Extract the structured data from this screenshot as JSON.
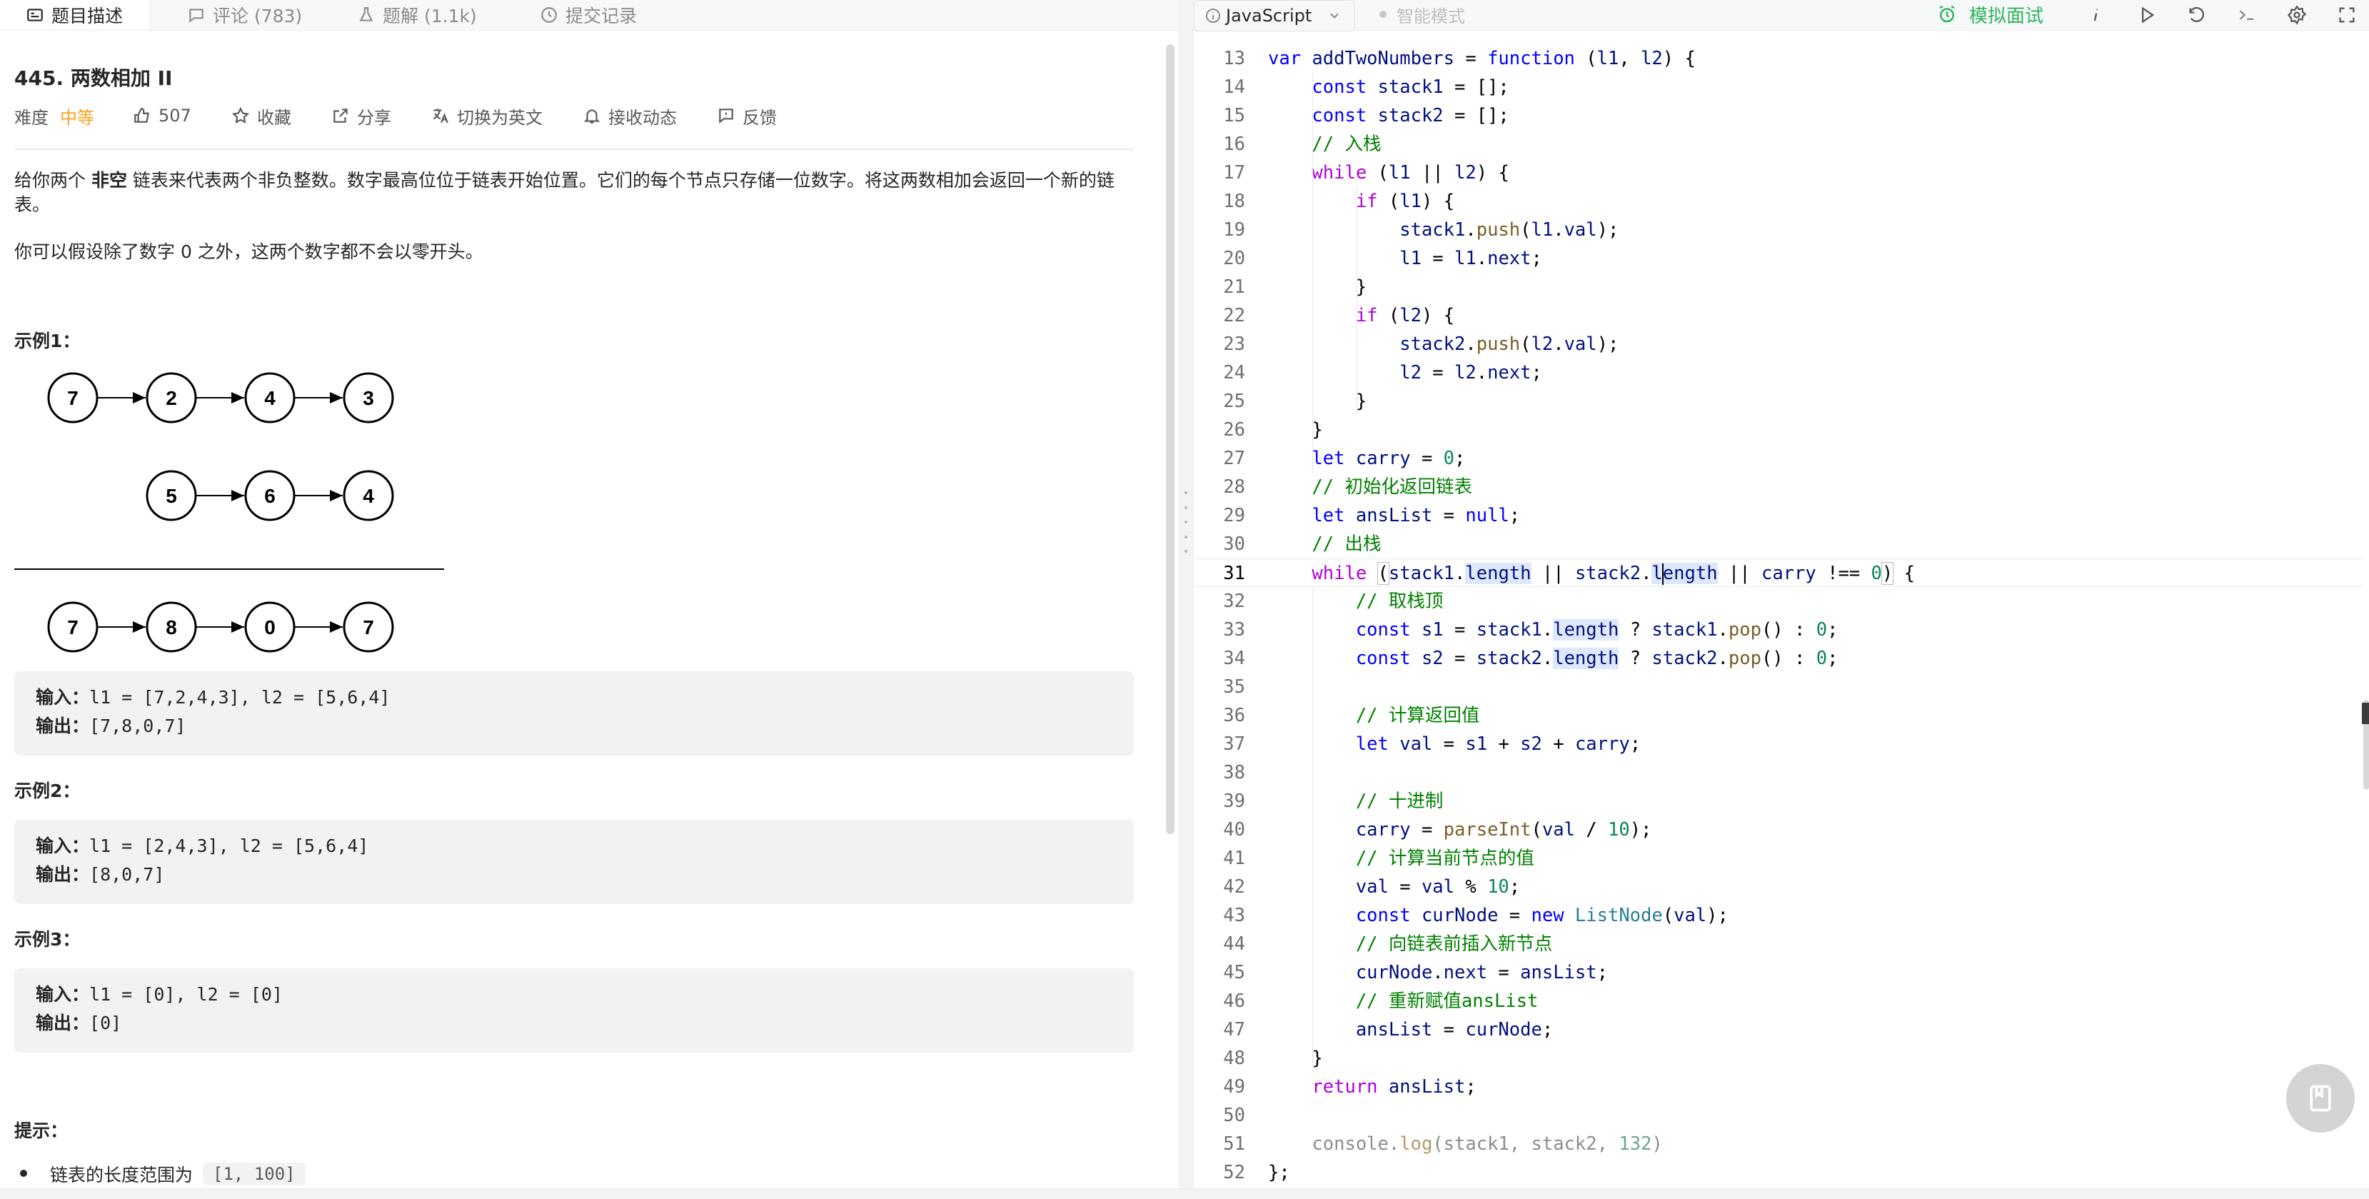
{
  "left_tabs": [
    {
      "label": "题目描述",
      "icon": "description-icon"
    },
    {
      "label": "评论 (783)",
      "icon": "comment-icon"
    },
    {
      "label": "题解 (1.1k)",
      "icon": "flask-icon"
    },
    {
      "label": "提交记录",
      "icon": "history-icon"
    }
  ],
  "problem": {
    "title": "445. 两数相加 II",
    "difficulty_label": "难度",
    "difficulty_value": "中等",
    "likes": "507",
    "favorite": "收藏",
    "share": "分享",
    "translate": "切换为英文",
    "subscribe": "接收动态",
    "feedback": "反馈",
    "desc_part1": "给你两个 ",
    "desc_bold": "非空",
    "desc_part2": " 链表来代表两个非负整数。数字最高位位于链表开始位置。它们的每个节点只存储一位数字。将这两数相加会返回一个新的链表。",
    "desc_note": "你可以假设除了数字 0 之外，这两个数字都不会以零开头。",
    "examples": [
      {
        "title": "示例1：",
        "input_label": "输入：",
        "input": "l1 = [7,2,4,3], l2 = [5,6,4]",
        "output_label": "输出：",
        "output": "[7,8,0,7]"
      },
      {
        "title": "示例2：",
        "input_label": "输入：",
        "input": "l1 = [2,4,3], l2 = [5,6,4]",
        "output_label": "输出：",
        "output": "[8,0,7]"
      },
      {
        "title": "示例3：",
        "input_label": "输入：",
        "input": "l1 = [0], l2 = [0]",
        "output_label": "输出：",
        "output": "[0]"
      }
    ],
    "diagram": {
      "row1": [
        "7",
        "2",
        "4",
        "3"
      ],
      "row2": [
        "5",
        "6",
        "4"
      ],
      "row3": [
        "7",
        "8",
        "0",
        "7"
      ]
    },
    "hints_title": "提示：",
    "hint1_text": "链表的长度范围为",
    "hint1_code": "[1, 100]"
  },
  "toolbar": {
    "language": "JavaScript",
    "smart_mode": "智能模式",
    "mock_interview": "模拟面试",
    "icons": [
      "info-icon",
      "run-icon",
      "reset-icon",
      "console-icon",
      "settings-icon",
      "fullscreen-icon"
    ]
  },
  "editor": {
    "first_line_number": 13,
    "current_line": 31,
    "line_numbers": [
      "13",
      "14",
      "15",
      "16",
      "17",
      "18",
      "19",
      "20",
      "21",
      "22",
      "23",
      "24",
      "25",
      "26",
      "27",
      "28",
      "29",
      "30",
      "31",
      "32",
      "33",
      "34",
      "35",
      "36",
      "37",
      "38",
      "39",
      "40",
      "41",
      "42",
      "43",
      "44",
      "45",
      "46",
      "47",
      "48",
      "49",
      "50",
      "51",
      "52"
    ],
    "code": [
      "var addTwoNumbers = function (l1, l2) {",
      "    const stack1 = [];",
      "    const stack2 = [];",
      "    // 入栈",
      "    while (l1 || l2) {",
      "        if (l1) {",
      "            stack1.push(l1.val);",
      "            l1 = l1.next;",
      "        }",
      "        if (l2) {",
      "            stack2.push(l2.val);",
      "            l2 = l2.next;",
      "        }",
      "    }",
      "    let carry = 0;",
      "    // 初始化返回链表",
      "    let ansList = null;",
      "    // 出栈",
      "    while (stack1.length || stack2.length || carry !== 0) {",
      "        // 取栈顶",
      "        const s1 = stack1.length ? stack1.pop() : 0;",
      "        const s2 = stack2.length ? stack2.pop() : 0;",
      "",
      "        // 计算返回值",
      "        let val = s1 + s2 + carry;",
      "",
      "        // 十进制",
      "        carry = parseInt(val / 10);",
      "        // 计算当前节点的值",
      "        val = val % 10;",
      "        const curNode = new ListNode(val);",
      "        // 向链表前插入新节点",
      "        curNode.next = ansList;",
      "        // 重新赋值ansList",
      "        ansList = curNode;",
      "    }",
      "    return ansList;",
      "",
      "    console.log(stack1, stack2, 132)",
      "};"
    ]
  },
  "colors": {
    "difficulty": "#ffa116",
    "mock_interview": "#2db55d",
    "keyword": "#0000ff",
    "control_keyword": "#af00db",
    "variable": "#001080",
    "function": "#795e26",
    "number": "#098658",
    "comment": "#008000",
    "type": "#267f99"
  }
}
